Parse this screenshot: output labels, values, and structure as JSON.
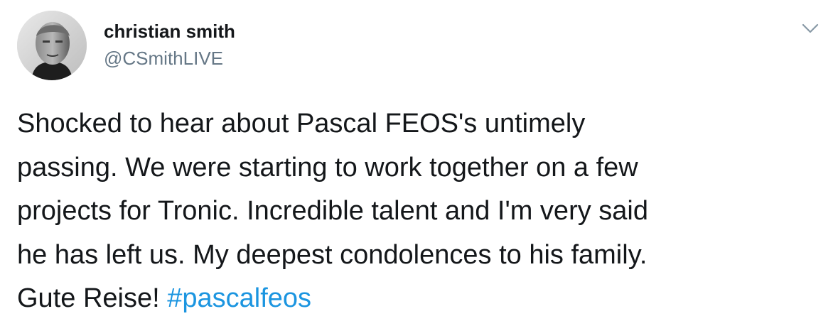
{
  "author": {
    "display_name": "christian smith",
    "handle": "@CSmithLIVE",
    "avatar_icon": "profile-photo"
  },
  "menu": {
    "icon": "chevron-down-icon"
  },
  "tweet": {
    "line1": "Shocked to hear about Pascal FEOS's untimely",
    "line2": "passing. We were starting to work together on a few",
    "line3": "projects for Tronic. Incredible talent and I'm very said",
    "line4": "he has left us. My deepest condolences to his family.",
    "line5_text": "Gute Reise! ",
    "hashtag": "#pascalfeos"
  },
  "colors": {
    "text": "#14171a",
    "secondary": "#657786",
    "link": "#1b95e0",
    "background": "#ffffff"
  }
}
